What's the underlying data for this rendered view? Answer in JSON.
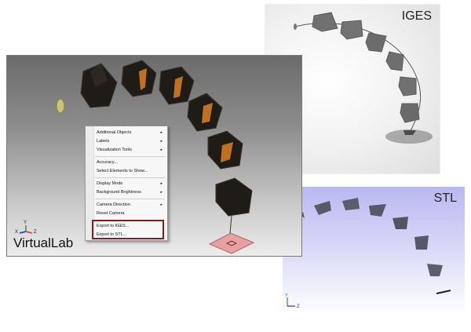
{
  "views": {
    "iges_label": "IGES",
    "stl_label": "STL",
    "virtuallab_label": "VirtualLab"
  },
  "context_menu": {
    "items": [
      {
        "label": "Additional Objects",
        "submenu": true
      },
      {
        "label": "Labels",
        "submenu": true
      },
      {
        "label": "Visualization Tools",
        "submenu": true
      },
      {
        "label": "Accuracy..."
      },
      {
        "label": "Select Elements to Show..."
      },
      {
        "label": "Display Mode",
        "submenu": true
      },
      {
        "label": "Background Brightness",
        "submenu": true
      },
      {
        "label": "Camera Direction",
        "submenu": true
      },
      {
        "label": "Reset Camera"
      },
      {
        "label": "Export to IGES..."
      },
      {
        "label": "Export to STL..."
      }
    ],
    "submenu_arrow": "▸",
    "highlighted_items": [
      "Export to IGES...",
      "Export to STL..."
    ]
  },
  "axes": {
    "vl": {
      "x": "X",
      "y": "Y",
      "z": "Z"
    },
    "stl": {
      "y": "Y",
      "z": "Z"
    }
  },
  "colors": {
    "highlight_box": "#8b1a1a",
    "prism_dark": "#1f1c18",
    "prism_orange": "#d07a22",
    "iges_shape": "#6f6f6f",
    "stl_shape": "#555b66",
    "detector_pink": "#e8a0a0",
    "source_yellow": "#c9c47a"
  }
}
